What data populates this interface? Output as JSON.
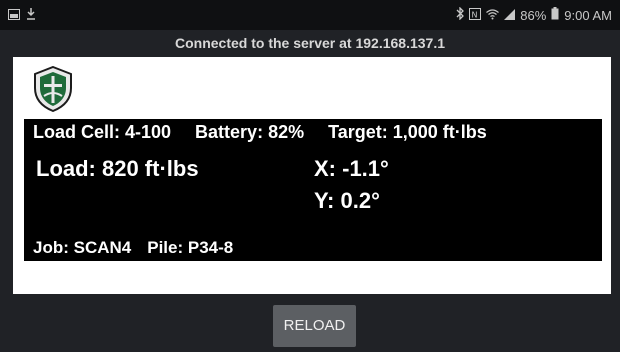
{
  "status_bar": {
    "battery": "86%",
    "time": "9:00 AM",
    "icons": [
      "image-icon",
      "download-icon",
      "bluetooth-icon",
      "nfc-icon",
      "wifi-icon",
      "signal-icon",
      "battery-icon"
    ]
  },
  "connection_message": "Connected to the server at 192.168.137.1",
  "display": {
    "load_cell": "Load Cell: 4-100",
    "battery": "Battery: 82%",
    "target": "Target: 1,000 ft·lbs",
    "load": "Load: 820 ft·lbs",
    "x": "X: -1.1°",
    "y": "Y: 0.2°",
    "job": "Job: SCAN4",
    "pile": "Pile: P34-8"
  },
  "actions": {
    "reload_label": "RELOAD"
  },
  "colors": {
    "background": "#202226",
    "status_bar": "#0f1012",
    "panel": "#ffffff",
    "display": "#000000",
    "button": "#5c5f63",
    "logo_green": "#1f6b3a"
  }
}
